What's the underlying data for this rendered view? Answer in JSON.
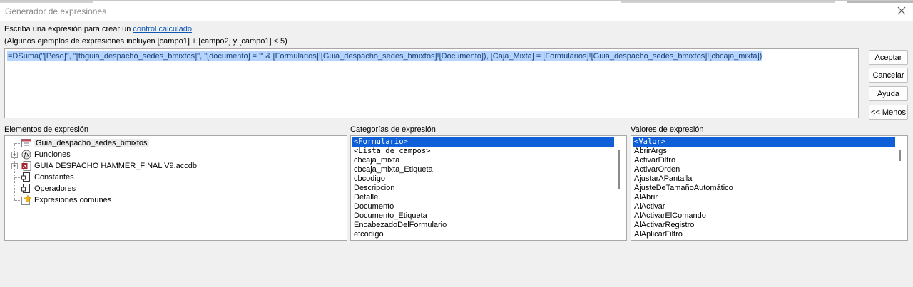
{
  "window": {
    "title": "Generador de expresiones"
  },
  "intro": {
    "line1_prefix": "Escriba una expresión para crear un ",
    "line1_link": "control calculado",
    "line1_suffix": ":",
    "line2": "(Algunos ejemplos de expresiones incluyen [campo1] + [campo2] y [campo1] < 5)"
  },
  "expression": {
    "value": "=DSuma(\"[Peso]\", \"[tbguia_despacho_sedes_bmixtos]\", \"[documento] = '\" & [Formularios]![Guia_despacho_sedes_bmixtos]![Documento]), [Caja_Mixta] = [Formularios]![Guia_despacho_sedes_bmixtos]![cbcaja_mixta])"
  },
  "buttons": {
    "ok": "Aceptar",
    "cancel": "Cancelar",
    "help": "Ayuda",
    "less": "<< Menos"
  },
  "elements": {
    "label": "Elementos de expresión",
    "items": [
      {
        "label": "Guia_despacho_sedes_bmixtos",
        "icon": "form-icon"
      },
      {
        "label": "Funciones",
        "icon": "function-icon"
      },
      {
        "label": "GUIA DESPACHO HAMMER_FINAL V9.accdb",
        "icon": "database-icon"
      },
      {
        "label": "Constantes",
        "icon": "constants-icon"
      },
      {
        "label": "Operadores",
        "icon": "operators-icon"
      },
      {
        "label": "Expresiones comunes",
        "icon": "common-expressions-icon"
      }
    ]
  },
  "categories": {
    "label": "Categorías de expresión",
    "items": [
      "<Formulario>",
      "<Lista de campos>",
      "cbcaja_mixta",
      "cbcaja_mixta_Etiqueta",
      "cbcodigo",
      "Descripcion",
      "Detalle",
      "Documento",
      "Documento_Etiqueta",
      "EncabezadoDelFormulario",
      "etcodigo"
    ]
  },
  "values": {
    "label": "Valores de expresión",
    "items": [
      "<Valor>",
      "AbrirArgs",
      "ActivarFiltro",
      "ActivarOrden",
      "AjustarAPantalla",
      "AjusteDeTamañoAutomático",
      "AlAbrir",
      "AlActivar",
      "AlActivarElComando",
      "AlActivarRegistro",
      "AlAplicarFiltro"
    ]
  },
  "colors": {
    "selection": "#0e5fd8",
    "expression_highlight": "#b5d5ff",
    "link": "#0d57b5"
  }
}
